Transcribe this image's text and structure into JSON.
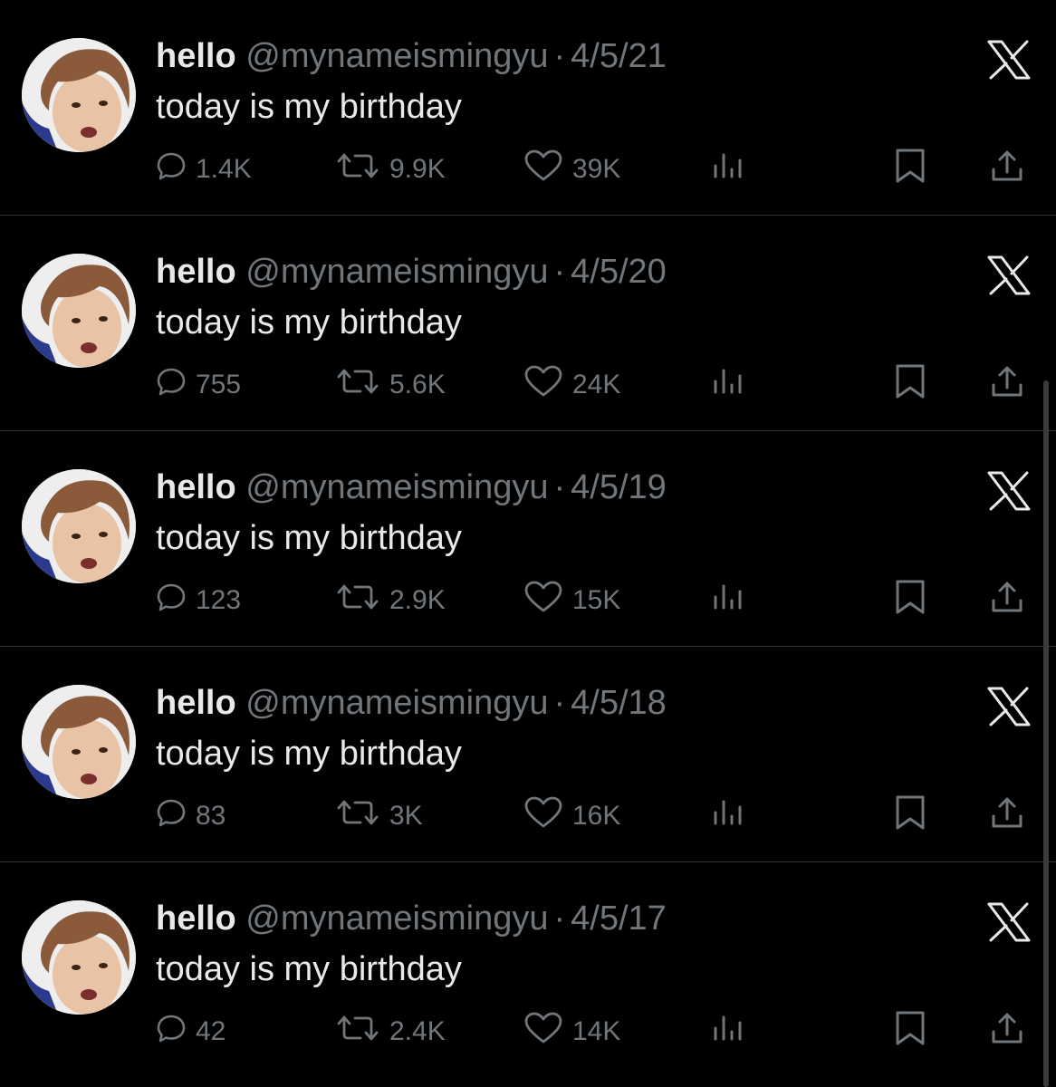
{
  "tweets": [
    {
      "name": "hello",
      "handle": "@mynameismingyu",
      "separator": "·",
      "date": "4/5/21",
      "text": "today is my birthday",
      "replies": "1.4K",
      "reposts": "9.9K",
      "likes": "39K"
    },
    {
      "name": "hello",
      "handle": "@mynameismingyu",
      "separator": "·",
      "date": "4/5/20",
      "text": "today is my birthday",
      "replies": "755",
      "reposts": "5.6K",
      "likes": "24K"
    },
    {
      "name": "hello",
      "handle": "@mynameismingyu",
      "separator": "·",
      "date": "4/5/19",
      "text": "today is my birthday",
      "replies": "123",
      "reposts": "2.9K",
      "likes": "15K"
    },
    {
      "name": "hello",
      "handle": "@mynameismingyu",
      "separator": "·",
      "date": "4/5/18",
      "text": "today is my birthday",
      "replies": "83",
      "reposts": "3K",
      "likes": "16K"
    },
    {
      "name": "hello",
      "handle": "@mynameismingyu",
      "separator": "·",
      "date": "4/5/17",
      "text": "today is my birthday",
      "replies": "42",
      "reposts": "2.4K",
      "likes": "14K"
    }
  ],
  "icons": {
    "platform_logo": "x-logo-icon",
    "reply": "speech-bubble-icon",
    "repost": "repost-arrows-icon",
    "like": "heart-icon",
    "views": "bar-chart-icon",
    "bookmark": "bookmark-icon",
    "share": "share-upload-icon"
  },
  "colors": {
    "background": "#000000",
    "primary_text": "#e7e9ea",
    "secondary_text": "#71767b",
    "divider": "#2f3336"
  }
}
